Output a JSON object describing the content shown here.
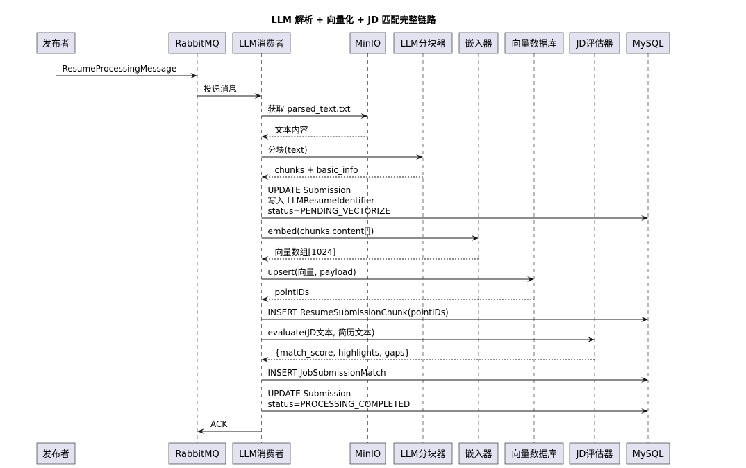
{
  "diagram": {
    "title": "LLM 解析 + 向量化 + JD 匹配完整链路",
    "participants": [
      {
        "id": "publisher",
        "label": "发布者"
      },
      {
        "id": "rabbitmq",
        "label": "RabbitMQ"
      },
      {
        "id": "consumer",
        "label": "LLM消费者"
      },
      {
        "id": "minio",
        "label": "MinIO"
      },
      {
        "id": "chunker",
        "label": "LLM分块器"
      },
      {
        "id": "embedder",
        "label": "嵌入器"
      },
      {
        "id": "vectordb",
        "label": "向量数据库"
      },
      {
        "id": "jdeval",
        "label": "JD评估器"
      },
      {
        "id": "mysql",
        "label": "MySQL"
      }
    ],
    "messages": [
      {
        "from": "publisher",
        "to": "rabbitmq",
        "lines": [
          "ResumeProcessingMessage"
        ],
        "dashed": false
      },
      {
        "from": "rabbitmq",
        "to": "consumer",
        "lines": [
          "投递消息"
        ],
        "dashed": false
      },
      {
        "from": "consumer",
        "to": "minio",
        "lines": [
          "获取 parsed_text.txt"
        ],
        "dashed": false
      },
      {
        "from": "minio",
        "to": "consumer",
        "lines": [
          "文本内容"
        ],
        "dashed": true
      },
      {
        "from": "consumer",
        "to": "chunker",
        "lines": [
          "分块(text)"
        ],
        "dashed": false
      },
      {
        "from": "chunker",
        "to": "consumer",
        "lines": [
          "chunks + basic_info"
        ],
        "dashed": true
      },
      {
        "from": "consumer",
        "to": "mysql",
        "lines": [
          "UPDATE Submission",
          "写入 LLMResumeIdentifier",
          "status=PENDING_VECTORIZE"
        ],
        "dashed": false
      },
      {
        "from": "consumer",
        "to": "embedder",
        "lines": [
          "embed(chunks.content[])"
        ],
        "dashed": false
      },
      {
        "from": "embedder",
        "to": "consumer",
        "lines": [
          "向量数组[1024]"
        ],
        "dashed": true
      },
      {
        "from": "consumer",
        "to": "vectordb",
        "lines": [
          "upsert(向量, payload)"
        ],
        "dashed": false
      },
      {
        "from": "vectordb",
        "to": "consumer",
        "lines": [
          "pointIDs"
        ],
        "dashed": true
      },
      {
        "from": "consumer",
        "to": "mysql",
        "lines": [
          "INSERT ResumeSubmissionChunk(pointIDs)"
        ],
        "dashed": false
      },
      {
        "from": "consumer",
        "to": "jdeval",
        "lines": [
          "evaluate(JD文本, 简历文本)"
        ],
        "dashed": false
      },
      {
        "from": "jdeval",
        "to": "consumer",
        "lines": [
          "{match_score, highlights, gaps}"
        ],
        "dashed": true
      },
      {
        "from": "consumer",
        "to": "mysql",
        "lines": [
          "INSERT JobSubmissionMatch"
        ],
        "dashed": false
      },
      {
        "from": "consumer",
        "to": "mysql",
        "lines": [
          "UPDATE Submission",
          "status=PROCESSING_COMPLETED"
        ],
        "dashed": false
      },
      {
        "from": "consumer",
        "to": "rabbitmq",
        "lines": [
          "ACK"
        ],
        "dashed": false
      }
    ]
  }
}
